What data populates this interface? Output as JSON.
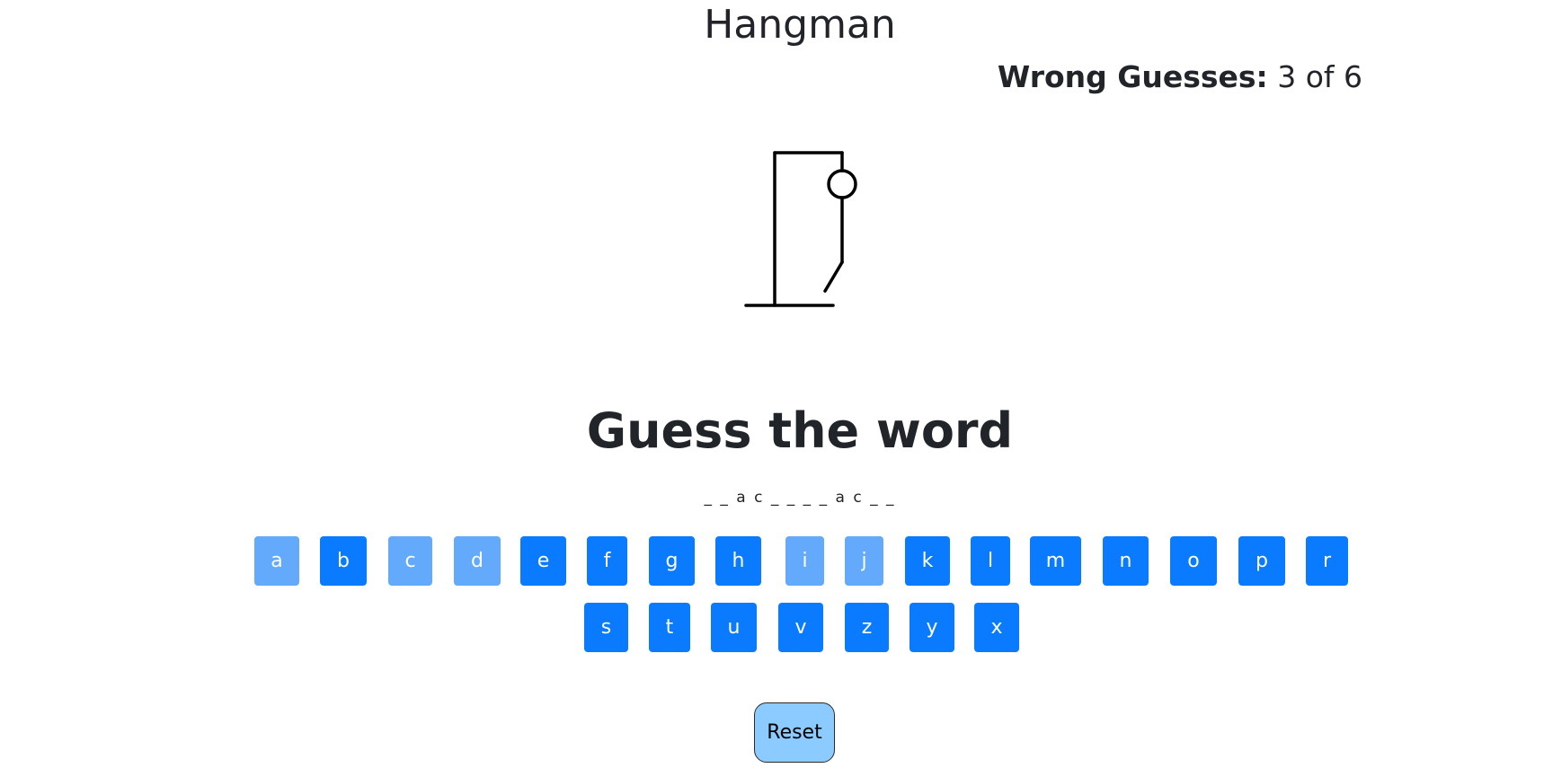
{
  "app": {
    "title": "Hangman"
  },
  "status": {
    "wrong_label": "Wrong Guesses:",
    "wrong_value": "3 of 6"
  },
  "game": {
    "heading": "Guess the word",
    "word_display": "_ _ a c _ _ _ _ a c _ _"
  },
  "keyboard": {
    "row1": [
      {
        "letter": "a",
        "used": true
      },
      {
        "letter": "b",
        "used": false
      },
      {
        "letter": "c",
        "used": true
      },
      {
        "letter": "d",
        "used": true
      },
      {
        "letter": "e",
        "used": false
      },
      {
        "letter": "f",
        "used": false
      },
      {
        "letter": "g",
        "used": false
      },
      {
        "letter": "h",
        "used": false
      },
      {
        "letter": "i",
        "used": true
      },
      {
        "letter": "j",
        "used": true
      },
      {
        "letter": "k",
        "used": false
      },
      {
        "letter": "l",
        "used": false
      },
      {
        "letter": "m",
        "used": false
      },
      {
        "letter": "n",
        "used": false
      },
      {
        "letter": "o",
        "used": false
      },
      {
        "letter": "p",
        "used": false
      },
      {
        "letter": "r",
        "used": false
      }
    ],
    "row2": [
      {
        "letter": "s",
        "used": false
      },
      {
        "letter": "t",
        "used": false
      },
      {
        "letter": "u",
        "used": false
      },
      {
        "letter": "v",
        "used": false
      },
      {
        "letter": "z",
        "used": false
      },
      {
        "letter": "y",
        "used": false
      },
      {
        "letter": "x",
        "used": false
      }
    ]
  },
  "actions": {
    "reset_label": "Reset"
  },
  "colors": {
    "key_active": "#0a7bff",
    "key_used": "#63a9fc",
    "reset_bg": "#8ccbff",
    "text": "#212529"
  }
}
